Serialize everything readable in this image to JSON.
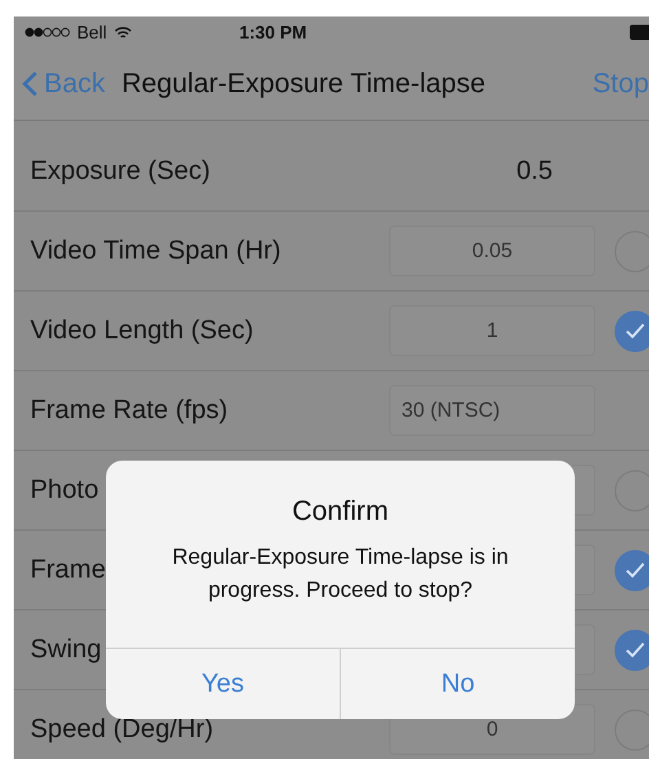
{
  "status_bar": {
    "carrier": "Bell",
    "time": "1:30 PM"
  },
  "nav": {
    "back": "Back",
    "title": "Regular-Exposure Time-lapse",
    "action": "Stop"
  },
  "rows": [
    {
      "label": "Exposure (Sec)",
      "kind": "readout",
      "value": "0.5"
    },
    {
      "label": "Video Time Span (Hr)",
      "kind": "field-check",
      "value": "0.05",
      "checked": false
    },
    {
      "label": "Video Length (Sec)",
      "kind": "field-check",
      "value": "1",
      "checked": true
    },
    {
      "label": "Frame Rate (fps)",
      "kind": "field",
      "value": "30 (NTSC)"
    },
    {
      "label": "Photo",
      "kind": "field-check",
      "checked": false
    },
    {
      "label": "Frame",
      "kind": "field-check",
      "checked": true
    },
    {
      "label": "Swing",
      "kind": "field-check",
      "checked": true
    },
    {
      "label": "Speed (Deg/Hr)",
      "kind": "field-check",
      "value": "0",
      "checked": false
    }
  ],
  "dialog": {
    "title": "Confirm",
    "message": "Regular-Exposure Time-lapse is in progress. Proceed to stop?",
    "buttons": [
      {
        "label": "Yes"
      },
      {
        "label": "No"
      }
    ]
  }
}
